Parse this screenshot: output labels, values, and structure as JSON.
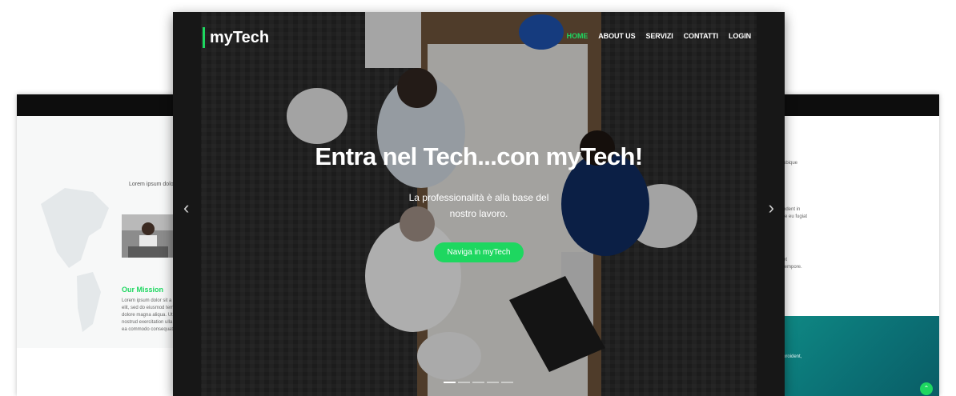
{
  "brand": {
    "name": "myTech",
    "accent": "#1ed760"
  },
  "nav": {
    "items": [
      {
        "label": "HOME",
        "active": true
      },
      {
        "label": "ABOUT US",
        "active": false
      },
      {
        "label": "SERVIZI",
        "active": false
      },
      {
        "label": "CONTATTI",
        "active": false
      },
      {
        "label": "LOGIN",
        "active": false
      }
    ]
  },
  "hero": {
    "title": "Entra nel Tech...con myTech!",
    "subtitle": "La professionalità è alla base del nostro lavoro.",
    "cta_label": "Naviga in myTech",
    "prev_icon": "chevron-left-icon",
    "next_icon": "chevron-right-icon",
    "prev_glyph": "‹",
    "next_glyph": "›",
    "slide_count": 5,
    "active_slide": 1
  },
  "left_page": {
    "heading": "Lorem ipsum dolo",
    "mission_title": "Our Mission",
    "mission_lines": [
      "Lorem ipsum dolor sit a",
      "elit, sed do eiusmod tem",
      "dolore magna aliqua. Ut",
      "nostrud exercitation ulla",
      "ea commodo consequat."
    ]
  },
  "right_page": {
    "lines_a": [
      "ubique"
    ],
    "lines_b": [
      "ndent in",
      "re eu fugiat"
    ],
    "lines_c": [
      "et",
      "tempore."
    ],
    "teal_text": "proident,",
    "up_icon": "arrow-up-icon",
    "up_glyph": "⌃"
  }
}
